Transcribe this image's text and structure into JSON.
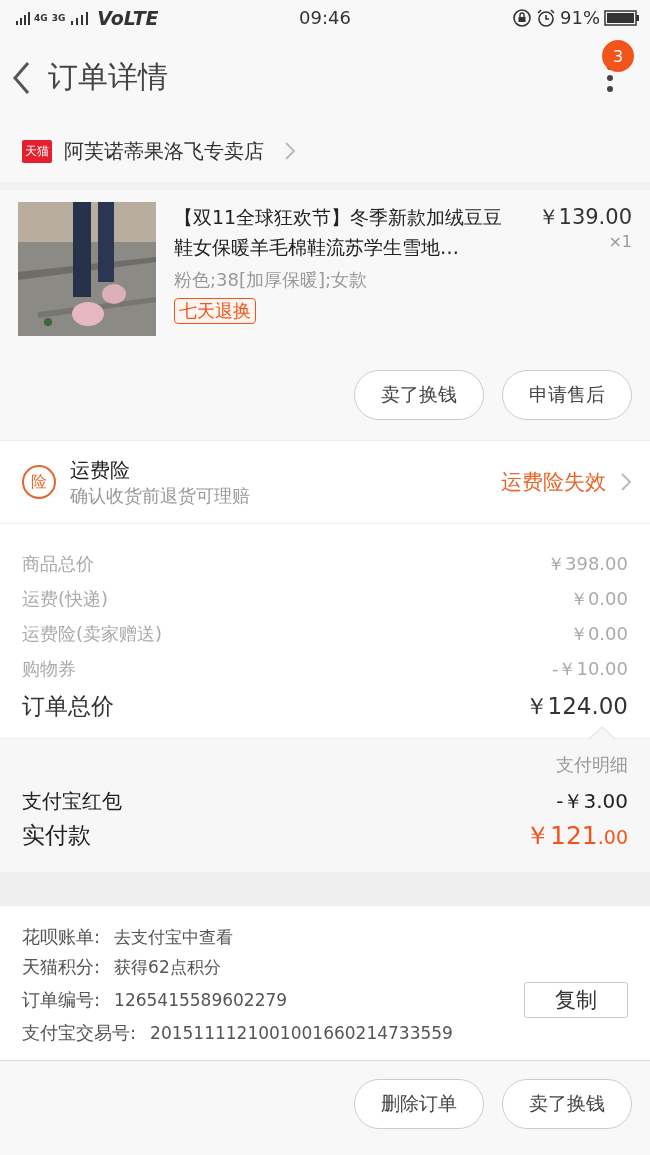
{
  "status_bar": {
    "network_1": "4G",
    "network_2": "3G",
    "volte": "VoLTE",
    "time": "09:46",
    "battery": "91%"
  },
  "header": {
    "title": "订单详情",
    "badge": "3"
  },
  "store": {
    "logo": "天猫",
    "name": "阿芙诺蒂果洛飞专卖店"
  },
  "product": {
    "title": "【双11全球狂欢节】冬季新款加绒豆豆鞋女保暖羊毛棉鞋流苏学生雪地…",
    "price": "￥139.00",
    "quantity": "×1",
    "sku": "粉色;38[加厚保暖];女款",
    "tag": "七天退换",
    "buttons": [
      "卖了换钱",
      "申请售后"
    ]
  },
  "insurance": {
    "icon_text": "险",
    "title": "运费险",
    "subtitle": "确认收货前退货可理赔",
    "status": "运费险失效"
  },
  "prices": [
    {
      "label": "商品总价",
      "value": "￥398.00",
      "kind": "minor"
    },
    {
      "label": "运费(快递)",
      "value": "￥0.00",
      "kind": "minor"
    },
    {
      "label": "运费险(卖家赠送)",
      "value": "￥0.00",
      "kind": "minor"
    },
    {
      "label": "购物券",
      "value": "-￥10.00",
      "kind": "minor"
    },
    {
      "label": "订单总价",
      "value": "￥124.00",
      "kind": "total"
    }
  ],
  "payment": {
    "detail_label": "支付明细",
    "rows": [
      {
        "label": "支付宝红包",
        "value": "-￥3.00"
      }
    ],
    "paid_label": "实付款",
    "paid_amount": "￥121",
    "paid_decimals": ".00"
  },
  "info": [
    {
      "label": "花呗账单:",
      "value": "去支付宝中查看"
    },
    {
      "label": "天猫积分:",
      "value": "获得62点积分"
    },
    {
      "label": "订单编号:",
      "value": "1265415589602279",
      "action": "复制"
    },
    {
      "label": "支付宝交易号:",
      "value": "2015111121001001660214733559"
    }
  ],
  "footer_buttons": [
    "删除订单",
    "卖了换钱"
  ]
}
